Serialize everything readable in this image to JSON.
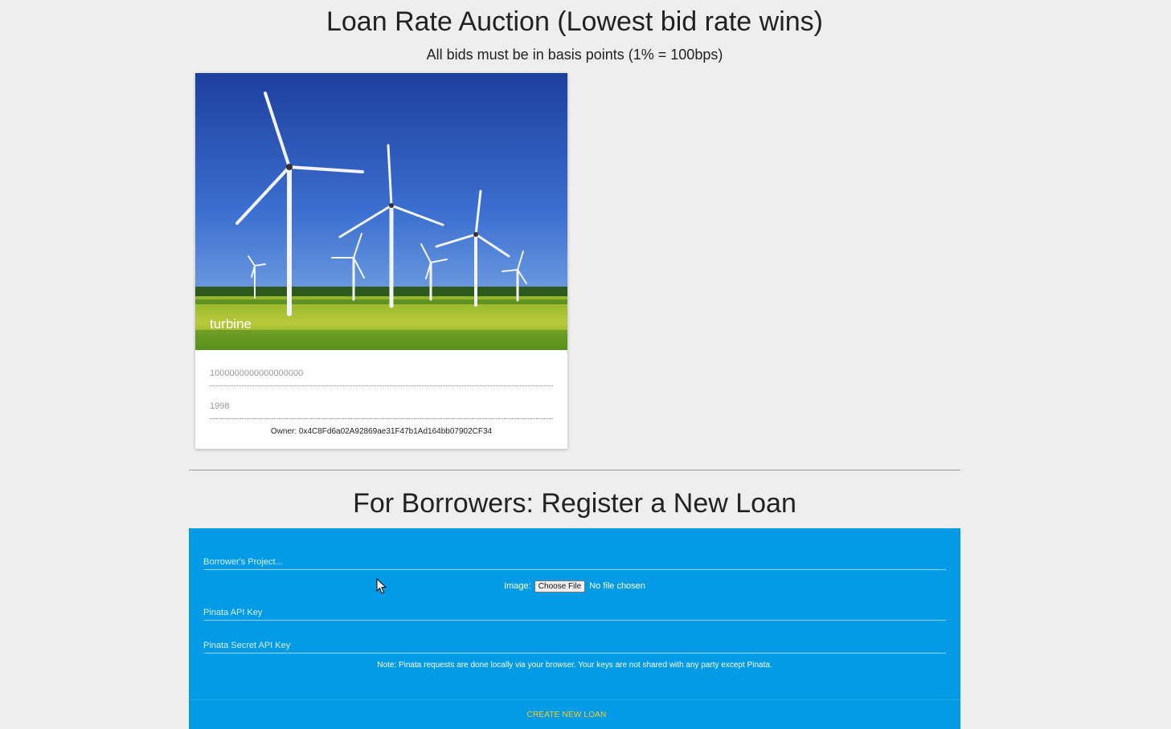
{
  "header": {
    "title": "Loan Rate Auction (Lowest bid rate wins)",
    "subtitle": "All bids must be in basis points (1% = 100bps)"
  },
  "loan_card": {
    "image_title": "turbine",
    "amount": "1000000000000000000",
    "rate": "1998",
    "owner": "Owner: 0x4C8Fd6a02A92869ae31F47b1Ad164bb07902CF34"
  },
  "register": {
    "title": "For Borrowers: Register a New Loan",
    "project_placeholder": "Borrower's Project...",
    "image_label": "Image:",
    "choose_file_label": "Choose File",
    "no_file_text": "No file chosen",
    "api_key_placeholder": "Pinata API Key",
    "secret_key_placeholder": "Pinata Secret API Key",
    "note": "Note: Pinata requests are done locally via your browser. Your keys are not shared with any party except Pinata.",
    "create_button": "CREATE NEW LOAN"
  },
  "colors": {
    "panel": "#039be5",
    "create_button_text": "#ffca28",
    "background": "#eeeeee"
  }
}
